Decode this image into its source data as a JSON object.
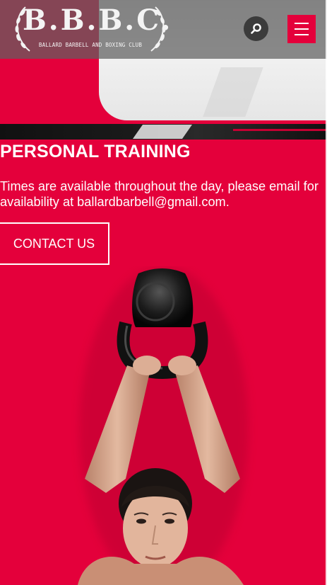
{
  "header": {
    "logo_main": "B.B.B.C.",
    "logo_sub": "BALLARD BARBELL AND BOXING CLUB",
    "search_icon": "search-icon",
    "menu_icon": "hamburger-menu-icon"
  },
  "section": {
    "title": "PERSONAL TRAINING",
    "description": "Times are available throughout the day, please email for availability at ballardbarbell@gmail.com.",
    "cta_label": "CONTACT US"
  },
  "colors": {
    "brand_red": "#e4003b",
    "header_overlay": "#606060",
    "text": "#ffffff"
  }
}
